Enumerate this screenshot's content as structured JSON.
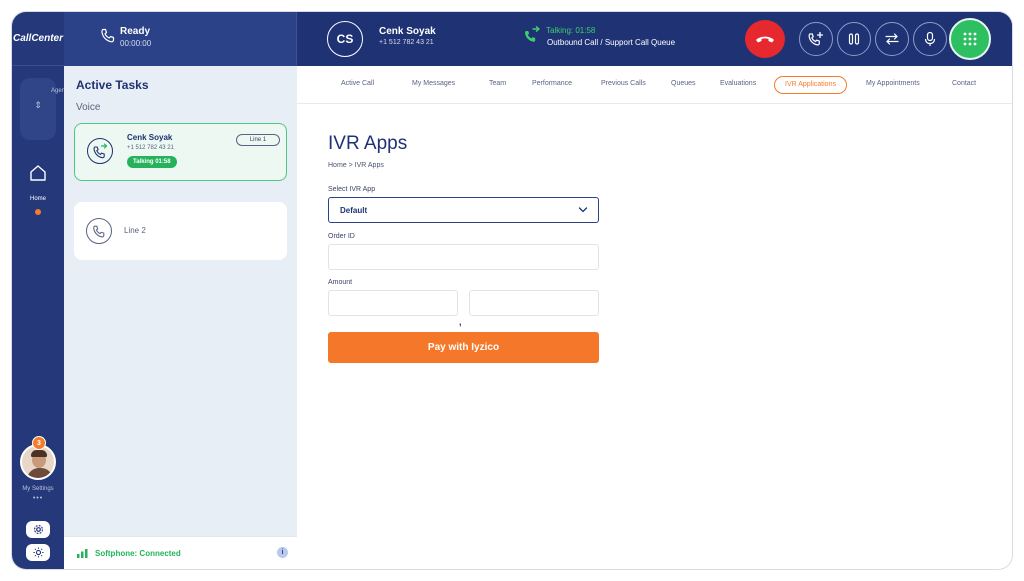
{
  "app": {
    "logo_text": "CallCenter"
  },
  "rail": {
    "agent_label": "Agent",
    "home_label": "Home",
    "notification_count": "3",
    "settings_label": "My Settings",
    "settings_dots": "•••"
  },
  "status": {
    "title": "Ready",
    "timer": "00:00:00"
  },
  "call": {
    "initials": "CS",
    "name": "Cenk Soyak",
    "number": "+1 512 782 43 21",
    "talking": "Talking: 01:58",
    "description": "Outbound Call / Support Call Queue"
  },
  "tasks": {
    "title": "Active Tasks",
    "subtitle": "Voice",
    "line1": {
      "name": "Cenk Soyak",
      "number": "+1 512 782 43 21",
      "badge": "Talking 01:58",
      "line_label": "Line 1"
    },
    "line2": {
      "label": "Line 2"
    }
  },
  "softphone": {
    "status": "Softphone: Connected",
    "info": "i"
  },
  "tabs": [
    "Active Call",
    "My Messages",
    "Team",
    "Performance",
    "Previous Calls",
    "Queues",
    "Evaluations",
    "IVR Applications",
    "My Appointments",
    "Contact"
  ],
  "active_tab": "IVR Applications",
  "page": {
    "title": "IVR Apps",
    "breadcrumb": "Home > IVR Apps",
    "select_label": "Select IVR App",
    "select_value": "Default",
    "order_label": "Order ID",
    "order_value": "",
    "amount_label": "Amount",
    "amount_separator": ",",
    "amount_whole": "",
    "amount_fraction": "",
    "pay_button": "Pay with Iyzico"
  },
  "colors": {
    "navy": "#1e3274",
    "accent": "#f47c2a",
    "green": "#25b25b",
    "hangup": "#e5292e"
  }
}
